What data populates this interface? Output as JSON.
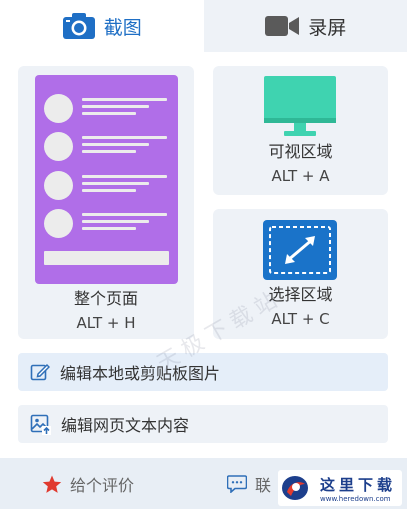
{
  "tabs": [
    {
      "label": "截图",
      "icon": "camera-icon",
      "active": true
    },
    {
      "label": "录屏",
      "icon": "video-camera-icon",
      "active": false
    }
  ],
  "cards": {
    "full_page": {
      "label": "整个页面",
      "shortcut": "ALT + H",
      "icon": "full-page-thumbnail"
    },
    "visible_area": {
      "label": "可视区域",
      "shortcut": "ALT + A",
      "icon": "monitor-icon"
    },
    "select_area": {
      "label": "选择区域",
      "shortcut": "ALT + C",
      "icon": "resize-arrows-icon"
    }
  },
  "actions": {
    "edit_local": {
      "label": "编辑本地或剪贴板图片",
      "icon": "edit-icon"
    },
    "edit_web": {
      "label": "编辑网页文本内容",
      "icon": "image-upload-icon"
    }
  },
  "footer": {
    "rate": {
      "label": "给个评价",
      "icon": "star-icon"
    },
    "contact": {
      "label": "联",
      "icon": "chat-icon"
    }
  },
  "watermark": {
    "text": "天极下载站"
  },
  "brand": {
    "cn": "这里下载",
    "url": "www.heredown.com"
  },
  "colors": {
    "accent_blue": "#1f6fc5",
    "thumb_purple": "#b06ee8",
    "monitor_green": "#3fd3b0",
    "select_blue": "#1a73c9",
    "star_red": "#e03a2f",
    "card_bg": "#eef2f7"
  }
}
